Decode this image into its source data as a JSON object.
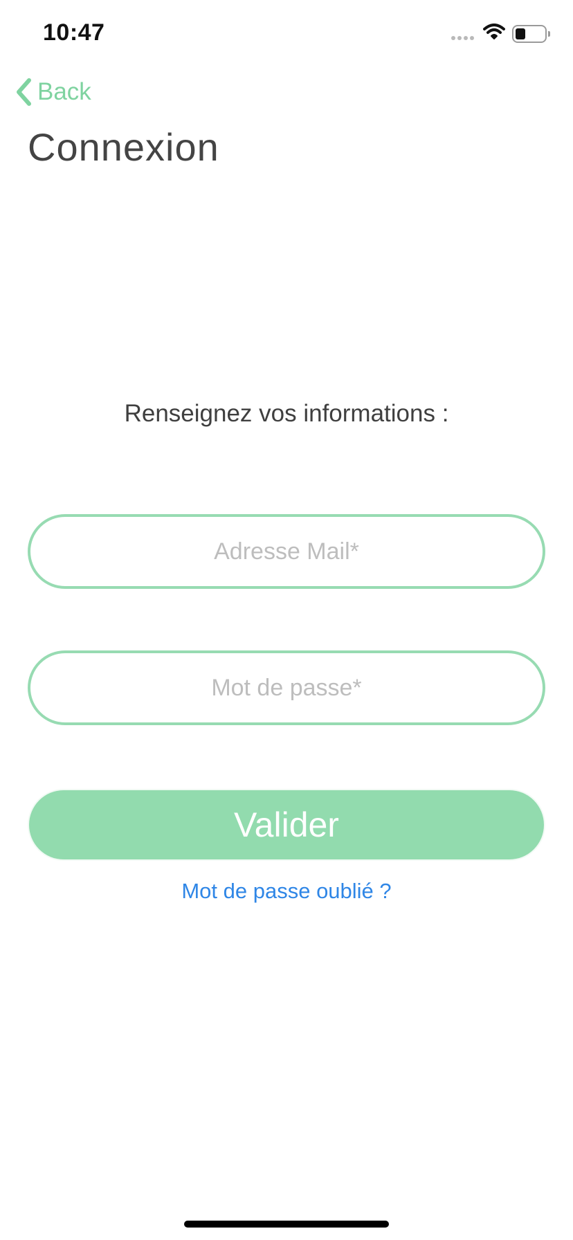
{
  "status_bar": {
    "time": "10:47",
    "icons": [
      "cellular-signal-icon",
      "wifi-icon",
      "battery-icon"
    ]
  },
  "nav": {
    "back_label": "Back",
    "back_icon": "chevron-left-icon"
  },
  "page": {
    "title": "Connexion",
    "instructions": "Renseignez vos informations :"
  },
  "form": {
    "email_placeholder": "Adresse Mail*",
    "email_value": "",
    "password_placeholder": "Mot de passe*",
    "password_value": "",
    "submit_label": "Valider",
    "forgot_password_label": "Mot de passe oublié ?"
  },
  "colors": {
    "accent_green": "#92dbae",
    "input_border": "#97dbb2",
    "back_text": "#7fd3a0",
    "link_blue": "#2f86e6",
    "title_text": "#444444"
  }
}
